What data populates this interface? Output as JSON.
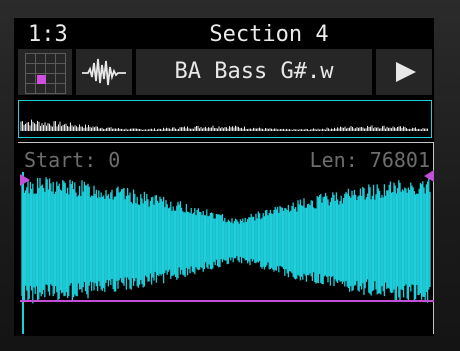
{
  "header": {
    "position": "1:3",
    "title": "Section 4"
  },
  "toolbar": {
    "grid_icon": "pad-grid-icon",
    "wave_icon": "waveform-icon",
    "file_name": "BA Bass G#.w",
    "play_icon": "play-icon"
  },
  "sample": {
    "start_label": "Start: 0",
    "length_label": "Len: 76801"
  },
  "colors": {
    "waveform": "#1fd0dc",
    "marker": "#c24fd8",
    "selected_pad": "#d04fe0"
  }
}
